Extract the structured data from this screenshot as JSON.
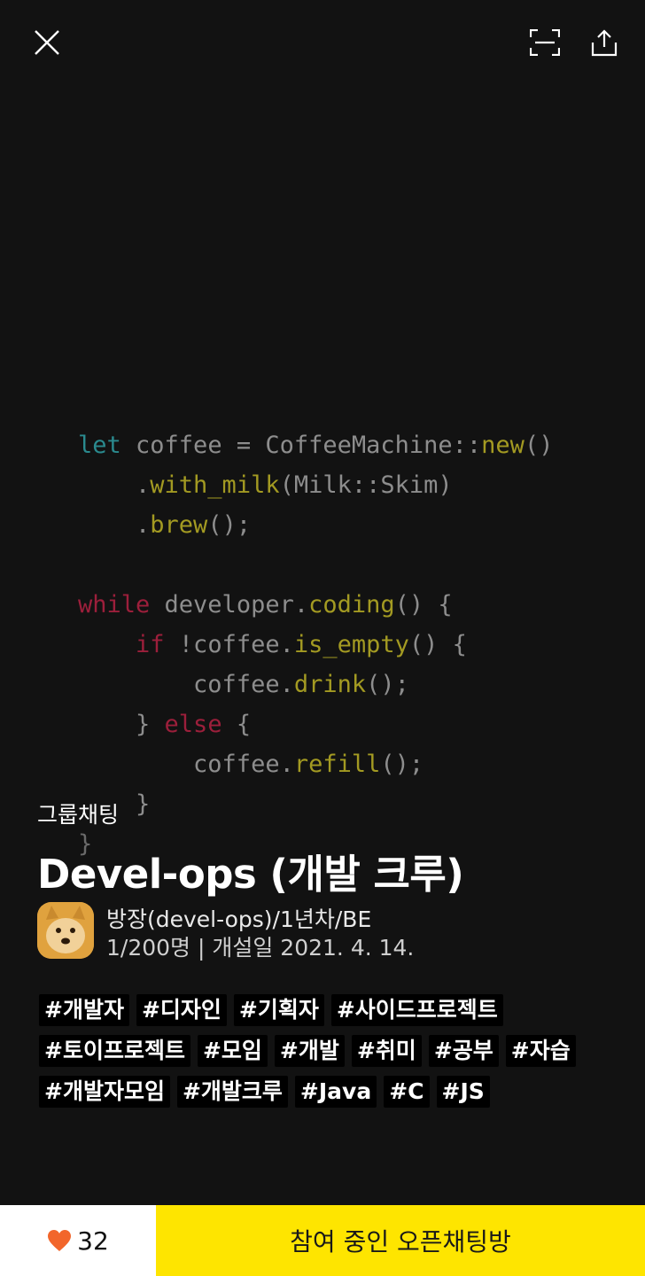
{
  "header": {
    "close_icon": "close-icon",
    "scan_icon": "scan-icon",
    "share_icon": "share-icon"
  },
  "code_background": {
    "lines": [
      [
        {
          "t": "let",
          "c": "kw-teal"
        },
        {
          "t": " coffee = CoffeeMachine::",
          "c": ""
        },
        {
          "t": "new",
          "c": "fn"
        },
        {
          "t": "()",
          "c": ""
        }
      ],
      [
        {
          "t": "    .",
          "c": ""
        },
        {
          "t": "with_milk",
          "c": "fn"
        },
        {
          "t": "(Milk::Skim)",
          "c": ""
        }
      ],
      [
        {
          "t": "    .",
          "c": ""
        },
        {
          "t": "brew",
          "c": "fn"
        },
        {
          "t": "();",
          "c": ""
        }
      ],
      [
        {
          "t": "",
          "c": ""
        }
      ],
      [
        {
          "t": "while",
          "c": "kw-red"
        },
        {
          "t": " developer.",
          "c": ""
        },
        {
          "t": "coding",
          "c": "fn"
        },
        {
          "t": "() {",
          "c": ""
        }
      ],
      [
        {
          "t": "    ",
          "c": ""
        },
        {
          "t": "if",
          "c": "kw-red"
        },
        {
          "t": " !coffee.",
          "c": ""
        },
        {
          "t": "is_empty",
          "c": "fn"
        },
        {
          "t": "() {",
          "c": ""
        }
      ],
      [
        {
          "t": "        coffee.",
          "c": ""
        },
        {
          "t": "drink",
          "c": "fn"
        },
        {
          "t": "();",
          "c": ""
        }
      ],
      [
        {
          "t": "    } ",
          "c": ""
        },
        {
          "t": "else",
          "c": "kw-red"
        },
        {
          "t": " {",
          "c": ""
        }
      ],
      [
        {
          "t": "        coffee.",
          "c": ""
        },
        {
          "t": "refill",
          "c": "fn"
        },
        {
          "t": "();",
          "c": ""
        }
      ],
      [
        {
          "t": "    }",
          "c": ""
        }
      ],
      [
        {
          "t": "}",
          "c": "dim"
        }
      ]
    ]
  },
  "room": {
    "type_label": "그룹채팅",
    "title": "Devel-ops (개발 크루)",
    "owner_label": "방장(devel-ops)/1년차/BE",
    "meta": "1/200명 | 개설일 2021. 4. 14."
  },
  "tags": [
    [
      "#개발자",
      "#디자인",
      "#기획자",
      "#사이드프로젝트"
    ],
    [
      "#토이프로젝트",
      "#모임",
      "#개발",
      "#취미",
      "#공부",
      "#자습"
    ],
    [
      "#개발자모임",
      "#개발크루",
      "#Java",
      "#C",
      "#JS"
    ]
  ],
  "bottom": {
    "heart_icon": "heart-icon",
    "like_count": "32",
    "join_label": "참여 중인 오픈채팅방"
  },
  "colors": {
    "background": "#121212",
    "join_button": "#fee500",
    "heart": "#f2662b"
  }
}
